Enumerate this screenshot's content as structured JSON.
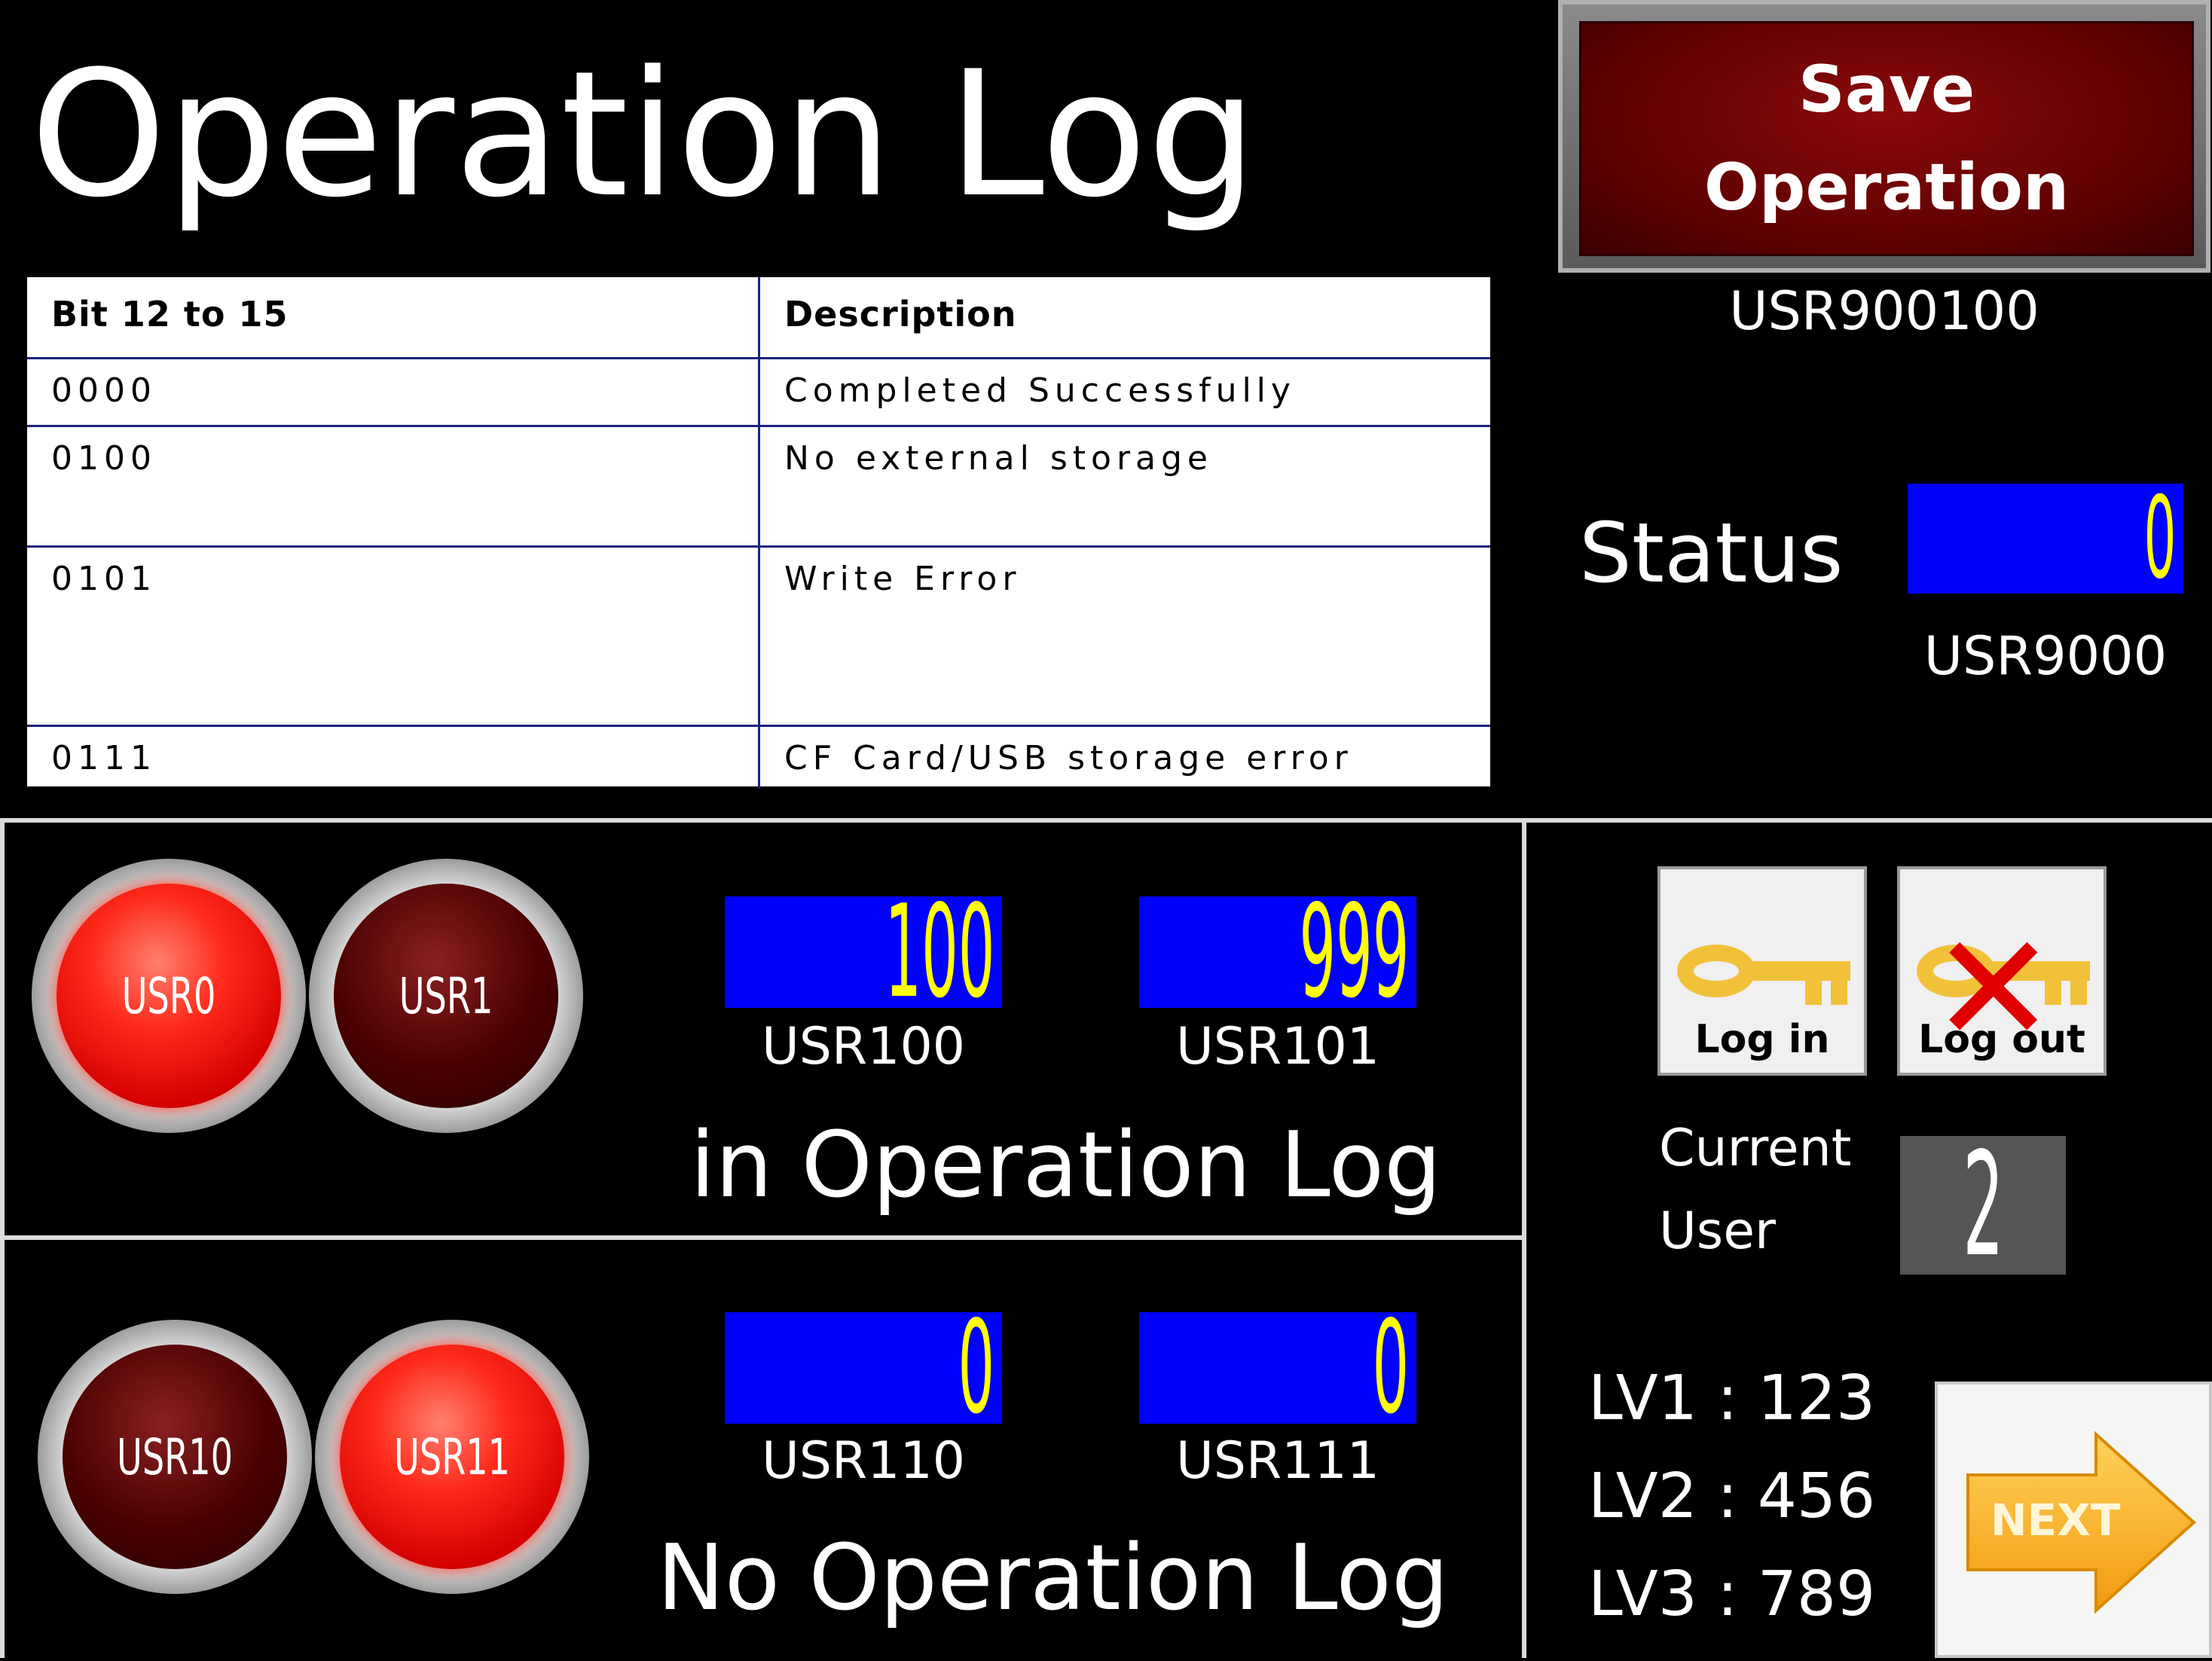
{
  "header": {
    "title": "Operation Log"
  },
  "save_button": {
    "line1": "Save",
    "line2": "Operation",
    "address": "USR900100"
  },
  "table": {
    "headers": [
      "Bit 12 to 15",
      "Description"
    ],
    "rows": [
      [
        "0000",
        "Completed Successfully"
      ],
      [
        "0100",
        "No external storage"
      ],
      [
        "0101",
        "Write Error"
      ],
      [
        "0111",
        "CF Card/USB storage error"
      ]
    ]
  },
  "status": {
    "label": "Status",
    "value": "0",
    "address": "USR9000"
  },
  "panel_in": {
    "buttons": [
      {
        "label": "USR0",
        "state": "on"
      },
      {
        "label": "USR1",
        "state": "off"
      }
    ],
    "values": [
      {
        "value": "100",
        "address": "USR100"
      },
      {
        "value": "999",
        "address": "USR101"
      }
    ],
    "caption": "in Operation Log"
  },
  "panel_no": {
    "buttons": [
      {
        "label": "USR10",
        "state": "off"
      },
      {
        "label": "USR11",
        "state": "on"
      }
    ],
    "values": [
      {
        "value": "0",
        "address": "USR110"
      },
      {
        "value": "0",
        "address": "USR111"
      }
    ],
    "caption": "No Operation Log"
  },
  "login": {
    "login_label": "Log in",
    "logout_label": "Log out",
    "login_icon": "key-icon",
    "logout_icon": "key-crossed-icon"
  },
  "current_user": {
    "label_line1": "Current",
    "label_line2": "User",
    "value": "2"
  },
  "levels": [
    "LV1 : 123",
    "LV2 : 456",
    "LV3 : 789"
  ],
  "next_button": {
    "label": "NEXT",
    "icon": "arrow-right-icon"
  },
  "colors": {
    "value_box_bg": "#0000ff",
    "value_text": "#ffff00",
    "button_on": "#ff2a1a",
    "button_off": "#4a0000",
    "save_bg": "#6a0000"
  }
}
